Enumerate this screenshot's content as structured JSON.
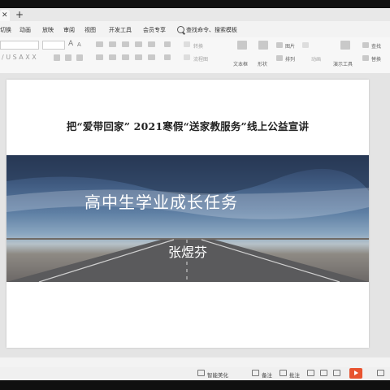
{
  "tabs": {
    "add": "+"
  },
  "menu": {
    "items": [
      "切换",
      "动画",
      "放映",
      "审阅",
      "视图",
      "开发工具",
      "会员专享"
    ],
    "search_placeholder": "查找命令、搜索模板"
  },
  "ribbon": {
    "font_size_up": "A",
    "font_size_down": "A",
    "text_box": "文本框",
    "shape": "形状",
    "picture": "图片",
    "arrange": "排列",
    "present_tools": "演示工具",
    "find": "查找",
    "replace": "替换",
    "smart_format": "智能美化",
    "gray_a": "转换",
    "gray_b": "流程图",
    "gray_c": "动画"
  },
  "slide": {
    "title": "把“爱带回家”  2021寒假“送家教服务”线上公益宣讲",
    "banner_title": "高中生学业成长任务",
    "banner_subtitle": "张煜芬"
  },
  "status": {
    "beautify": "智能美化",
    "notes": "备注",
    "comments": "批注"
  }
}
